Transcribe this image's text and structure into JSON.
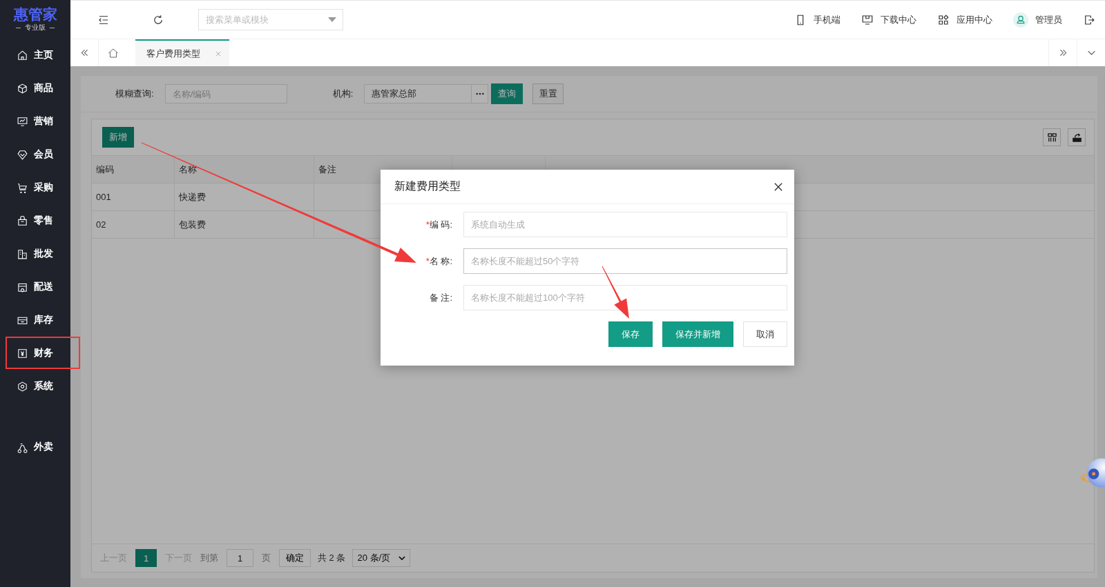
{
  "sidebar": {
    "logo": "惠管家",
    "edition": "专业版",
    "groups": [
      {
        "items": [
          {
            "label": "主页",
            "highlighted": false
          },
          {
            "label": "商品",
            "highlighted": false
          },
          {
            "label": "营销",
            "highlighted": false
          },
          {
            "label": "会员",
            "highlighted": false
          },
          {
            "label": "采购",
            "highlighted": false
          },
          {
            "label": "零售",
            "highlighted": false
          },
          {
            "label": "批发",
            "highlighted": false
          },
          {
            "label": "配送",
            "highlighted": false
          },
          {
            "label": "库存",
            "highlighted": false
          },
          {
            "label": "财务",
            "highlighted": true
          },
          {
            "label": "系统",
            "highlighted": false
          }
        ]
      },
      {
        "items": [
          {
            "label": "外卖",
            "highlighted": false
          }
        ]
      }
    ]
  },
  "header": {
    "search": {
      "placeholder": "搜索菜单或模块"
    },
    "links": [
      {
        "label": "手机端"
      },
      {
        "label": "下载中心"
      },
      {
        "label": "应用中心"
      }
    ],
    "user": "管理员"
  },
  "tabs": [
    {
      "label": "客户费用类型",
      "selected": true
    }
  ],
  "filters": [
    {
      "label": "模糊查询:",
      "placeholder": "名称/编码"
    },
    {
      "label": "机构:",
      "value": "惠管家总部"
    }
  ],
  "filter_buttons": {
    "query": "查询",
    "reset": "重置"
  },
  "table": {
    "add_button": "新增",
    "columns": [
      "编码",
      "名称",
      "备注"
    ],
    "rows": [
      {
        "code": "001",
        "name": "快递费"
      },
      {
        "code": "02",
        "name": "包装费"
      }
    ]
  },
  "pagination": {
    "prev": "上一页",
    "pages": [
      {
        "label": "1",
        "selected": true
      }
    ],
    "next": "下一页",
    "goto_label": "到第",
    "goto_value": "1",
    "page_unit": "页",
    "confirm": "确定",
    "total": "共 2 条",
    "page_size": "20 条/页"
  },
  "dialog": {
    "title": "新建费用类型",
    "required_mark": "*",
    "fields": [
      {
        "label": "编 码:",
        "required": true,
        "placeholder": "系统自动生成",
        "focused": false
      },
      {
        "label": "名 称:",
        "required": true,
        "placeholder": "名称长度不能超过50个字符",
        "focused": true
      },
      {
        "label": "备 注:",
        "required": false,
        "placeholder": "名称长度不能超过100个字符",
        "focused": false
      }
    ],
    "buttons": [
      {
        "label": "保存",
        "kind": "primary"
      },
      {
        "label": "保存并新增",
        "kind": "primary"
      },
      {
        "label": "取消",
        "kind": "default"
      }
    ]
  }
}
